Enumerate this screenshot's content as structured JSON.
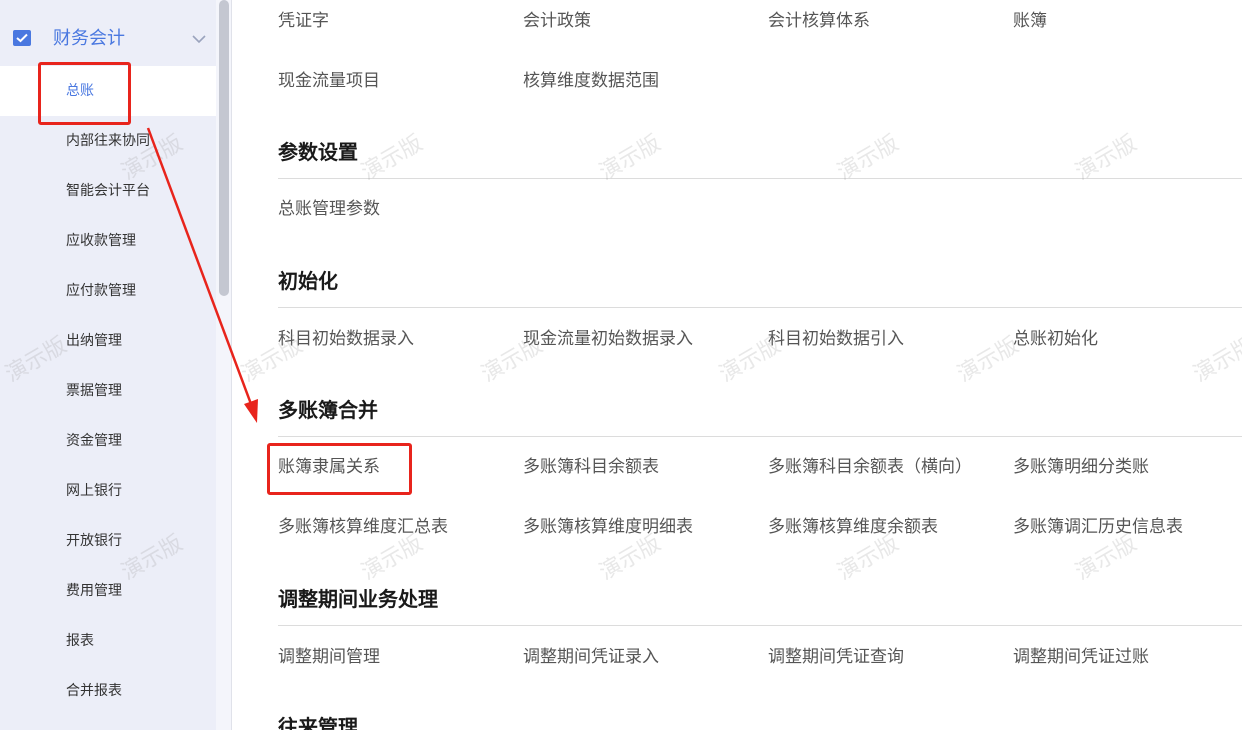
{
  "sidebar": {
    "header_title": "财务会计",
    "header_icon": "finance-check-icon",
    "chevron_icon": "chevron-down-icon",
    "items": [
      {
        "label": "总账",
        "active": true
      },
      {
        "label": "内部往来协同"
      },
      {
        "label": "智能会计平台"
      },
      {
        "label": "应收款管理"
      },
      {
        "label": "应付款管理"
      },
      {
        "label": "出纳管理"
      },
      {
        "label": "票据管理"
      },
      {
        "label": "资金管理"
      },
      {
        "label": "网上银行"
      },
      {
        "label": "开放银行"
      },
      {
        "label": "费用管理"
      },
      {
        "label": "报表"
      },
      {
        "label": "合并报表"
      }
    ]
  },
  "main": {
    "top_links_row1": [
      "凭证字",
      "会计政策",
      "会计核算体系",
      "账簿"
    ],
    "top_links_row2": [
      "现金流量项目",
      "核算维度数据范围"
    ],
    "sections": [
      {
        "title": "参数设置",
        "rows": [
          [
            "总账管理参数"
          ]
        ]
      },
      {
        "title": "初始化",
        "rows": [
          [
            "科目初始数据录入",
            "现金流量初始数据录入",
            "科目初始数据引入",
            "总账初始化"
          ]
        ]
      },
      {
        "title": "多账簿合并",
        "rows": [
          [
            "账簿隶属关系",
            "多账簿科目余额表",
            "多账簿科目余额表（横向）",
            "多账簿明细分类账"
          ],
          [
            "多账簿核算维度汇总表",
            "多账簿核算维度明细表",
            "多账簿核算维度余额表",
            "多账簿调汇历史信息表"
          ]
        ]
      },
      {
        "title": "调整期间业务处理",
        "rows": [
          [
            "调整期间管理",
            "调整期间凭证录入",
            "调整期间凭证查询",
            "调整期间凭证过账"
          ]
        ]
      },
      {
        "title": "往来管理",
        "rows": []
      }
    ]
  },
  "watermark_text": "演示版",
  "colors": {
    "accent": "#4a78e0",
    "annotation_red": "#e8241c",
    "sidebar_bg": "#eceef8"
  }
}
